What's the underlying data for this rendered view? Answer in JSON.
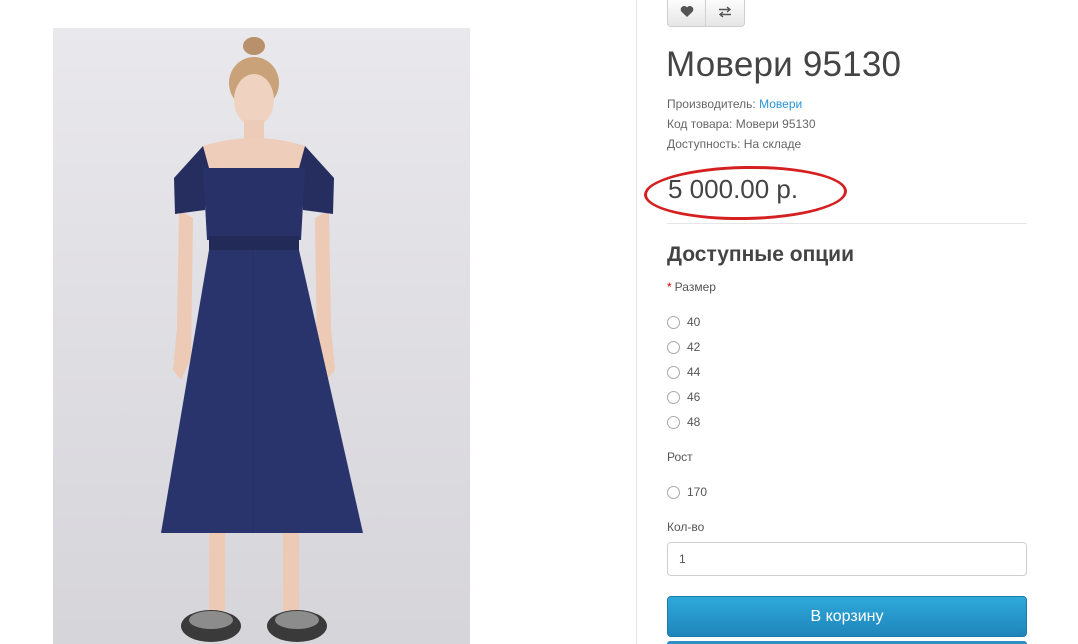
{
  "product": {
    "title": "Мовери 95130",
    "manufacturer_label": "Производитель:",
    "manufacturer_value": "Мовери",
    "code_label": "Код товара:",
    "code_value": "Мовери 95130",
    "availability_label": "Доступность:",
    "availability_value": "На складе",
    "price": "5 000.00 р."
  },
  "actions": {
    "wishlist_icon": "heart-icon",
    "compare_icon": "compare-arrows-icon"
  },
  "options": {
    "title": "Доступные опции",
    "size": {
      "required_mark": "*",
      "label": "Размер",
      "values": [
        "40",
        "42",
        "44",
        "46",
        "48"
      ]
    },
    "height": {
      "label": "Рост",
      "values": [
        "170"
      ]
    },
    "quantity": {
      "label": "Кол-во",
      "value": "1"
    }
  },
  "cart_button": "В корзину",
  "colors": {
    "link": "#2a93d6",
    "highlight_oval": "#d42020",
    "cart_button": "#2399cd"
  }
}
